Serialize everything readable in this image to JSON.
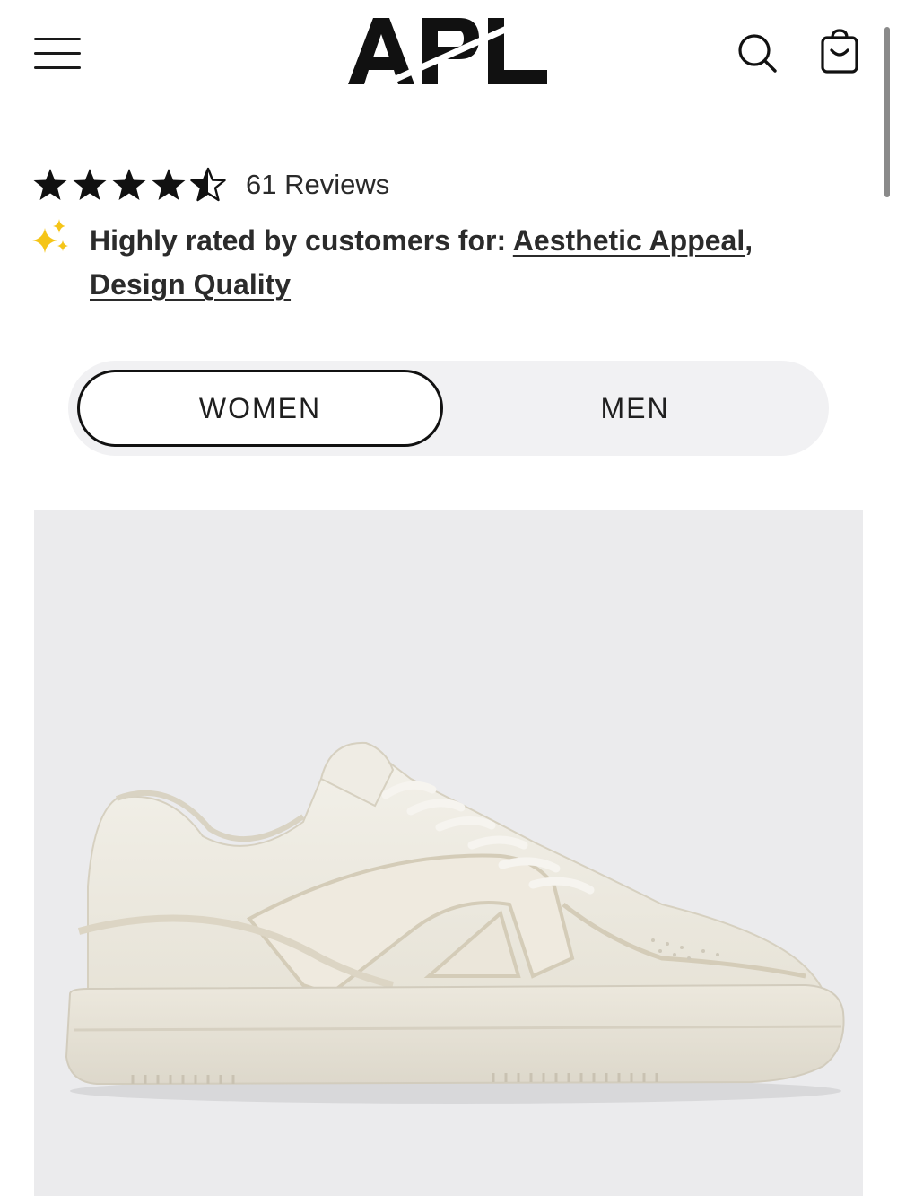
{
  "header": {
    "brand": "APL",
    "menu_icon": "hamburger-menu-icon",
    "search_icon": "search-icon",
    "cart_icon": "shopping-bag-icon"
  },
  "rating": {
    "value": 4.5,
    "max": 5,
    "reviews_label": "61 Reviews"
  },
  "highlights": {
    "icon": "sparkle-icon",
    "prefix": "Highly rated by customers for:",
    "attribute_1": "Aesthetic Appeal",
    "separator": ",",
    "attribute_2": "Design Quality"
  },
  "gender_tabs": {
    "women_label": "WOMEN",
    "men_label": "MEN",
    "selected": "WOMEN"
  },
  "product": {
    "image": "white-low-top-sneaker"
  },
  "colors": {
    "star": "#111111",
    "sparkle": "#f5c518",
    "image_bg": "#ebebed",
    "toggle_bg": "#f1f1f3"
  }
}
